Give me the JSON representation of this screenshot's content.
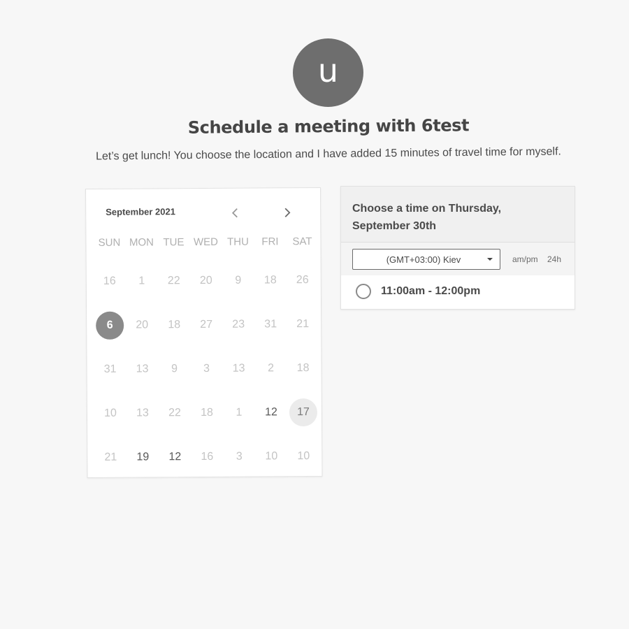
{
  "header": {
    "avatar_letter": "u",
    "title": "Schedule a meeting with 6test",
    "description": "Let’s get lunch! You choose the location and I have added 15 minutes of travel time for myself."
  },
  "calendar": {
    "month_label": "September 2021",
    "prev_icon": "chevron-left-icon",
    "next_icon": "chevron-right-icon",
    "weekdays": [
      "SUN",
      "MON",
      "TUE",
      "WED",
      "THU",
      "FRI",
      "SAT"
    ],
    "weeks": [
      [
        "16",
        "1",
        "22",
        "20",
        "9",
        "18",
        "26"
      ],
      [
        "6",
        "20",
        "18",
        "27",
        "23",
        "31",
        "21"
      ],
      [
        "31",
        "13",
        "9",
        "3",
        "13",
        "2",
        "18"
      ],
      [
        "10",
        "13",
        "22",
        "18",
        "1",
        "12",
        "17"
      ],
      [
        "21",
        "19",
        "12",
        "16",
        "3",
        "10",
        "10"
      ]
    ],
    "selected_day": "6",
    "today_day": "17",
    "available_days": [
      "12",
      "19"
    ]
  },
  "time_panel": {
    "heading_line1": "Choose a time on Thursday,",
    "heading_line2": "September 30th",
    "timezone_value": "(GMT+03:00) Kiev",
    "format_ampm": "am/pm",
    "format_24h": "24h",
    "slots": [
      {
        "label": "11:00am - 12:00pm",
        "selected": false
      }
    ]
  },
  "colors": {
    "background": "#f7f7f7",
    "avatar": "#6e6e6e",
    "selected_day": "#8a8a8a",
    "today_day": "#ebebeb",
    "header_panel": "#f0f0f0"
  }
}
